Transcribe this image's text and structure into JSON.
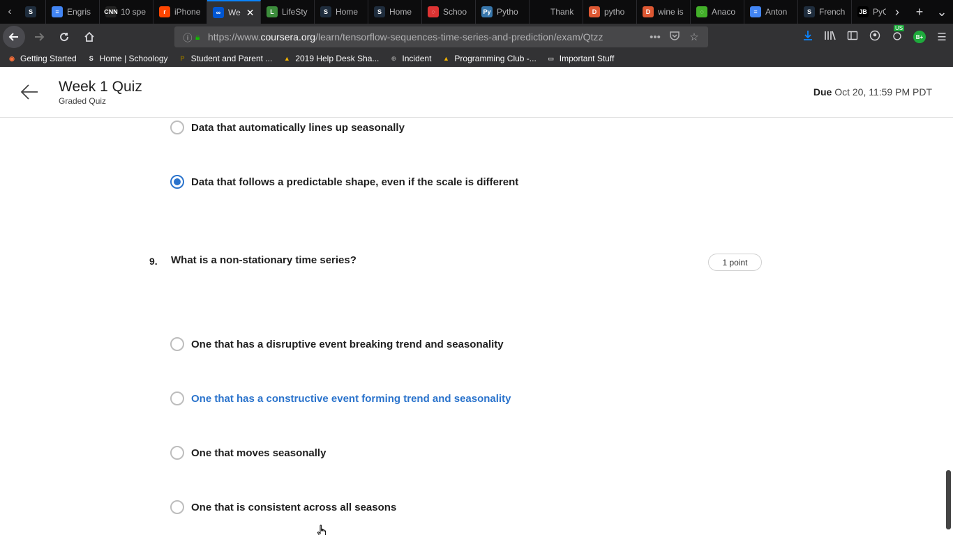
{
  "browser": {
    "tabs": [
      {
        "title": "",
        "icon": "schoology-icon",
        "color": "#1f2d3d",
        "glyph": "S"
      },
      {
        "title": "Engris",
        "icon": "google-docs-icon",
        "color": "#4285f4",
        "glyph": "≡"
      },
      {
        "title": "10 spe",
        "icon": "cnn-icon",
        "color": "#222",
        "glyph": "CNN"
      },
      {
        "title": "iPhone",
        "icon": "reddit-icon",
        "color": "#ff4500",
        "glyph": "r"
      },
      {
        "title": "We",
        "icon": "coursera-icon",
        "color": "#0056d2",
        "glyph": "∞",
        "active": true
      },
      {
        "title": "LifeSty",
        "icon": "lifestyle-icon",
        "color": "#3c8d3c",
        "glyph": "L"
      },
      {
        "title": "Home",
        "icon": "schoology-icon",
        "color": "#1f2d3d",
        "glyph": "S"
      },
      {
        "title": "Home",
        "icon": "schoology-icon",
        "color": "#1f2d3d",
        "glyph": "S"
      },
      {
        "title": "Schoo",
        "icon": "loading-icon",
        "color": "#d33",
        "glyph": "◌"
      },
      {
        "title": "Pytho",
        "icon": "python-icon",
        "color": "#3776ab",
        "glyph": "Py"
      },
      {
        "title": "Thank",
        "icon": "blank-icon",
        "color": "#0c0c0d",
        "glyph": ""
      },
      {
        "title": "pytho",
        "icon": "duckduckgo-icon",
        "color": "#de5833",
        "glyph": "D"
      },
      {
        "title": "wine is",
        "icon": "duckduckgo-icon",
        "color": "#de5833",
        "glyph": "D"
      },
      {
        "title": "Anaco",
        "icon": "anaconda-icon",
        "color": "#43b02a",
        "glyph": "◌"
      },
      {
        "title": "Anton",
        "icon": "google-docs-icon",
        "color": "#4285f4",
        "glyph": "≡"
      },
      {
        "title": "French",
        "icon": "schoology-icon",
        "color": "#1f2d3d",
        "glyph": "S"
      },
      {
        "title": "PyCha",
        "icon": "jetbrains-icon",
        "color": "#000",
        "glyph": "JB"
      }
    ],
    "url_prefix": "https://www.",
    "url_domain": "coursera.org",
    "url_path": "/learn/tensorflow-sequences-time-series-and-prediction/exam/Qtzz",
    "ext_badge": "US",
    "ext_label": "B+",
    "bookmarks": [
      {
        "label": "Getting Started",
        "icon": "firefox-icon"
      },
      {
        "label": "Home | Schoology",
        "icon": "schoology-icon"
      },
      {
        "label": "Student and Parent ...",
        "icon": "bookmark-p-icon"
      },
      {
        "label": "2019 Help Desk Sha...",
        "icon": "google-drive-icon"
      },
      {
        "label": "Incident",
        "icon": "globe-icon"
      },
      {
        "label": "Programming Club -...",
        "icon": "google-drive-icon"
      },
      {
        "label": "Important Stuff",
        "icon": "folder-icon"
      }
    ]
  },
  "header": {
    "title": "Week 1 Quiz",
    "subtitle": "Graded Quiz",
    "due_label": "Due",
    "due_value": "Oct 20, 11:59 PM PDT"
  },
  "prev_question": {
    "options": [
      {
        "label": "Data that automatically lines up seasonally",
        "checked": false
      },
      {
        "label": "Data that follows a predictable shape, even if the scale is different",
        "checked": true
      }
    ]
  },
  "question": {
    "number": "9.",
    "text": "What is a non-stationary time series?",
    "points": "1 point",
    "options": [
      {
        "label": "One that has a disruptive event breaking trend and seasonality",
        "checked": false
      },
      {
        "label": "One that has a constructive event forming trend and seasonality",
        "checked": false,
        "hover": true
      },
      {
        "label": "One that moves seasonally",
        "checked": false
      },
      {
        "label": "One that is consistent across all seasons",
        "checked": false
      }
    ]
  },
  "colors": {
    "accent": "#2a73cc",
    "text": "#1f1f1f"
  }
}
